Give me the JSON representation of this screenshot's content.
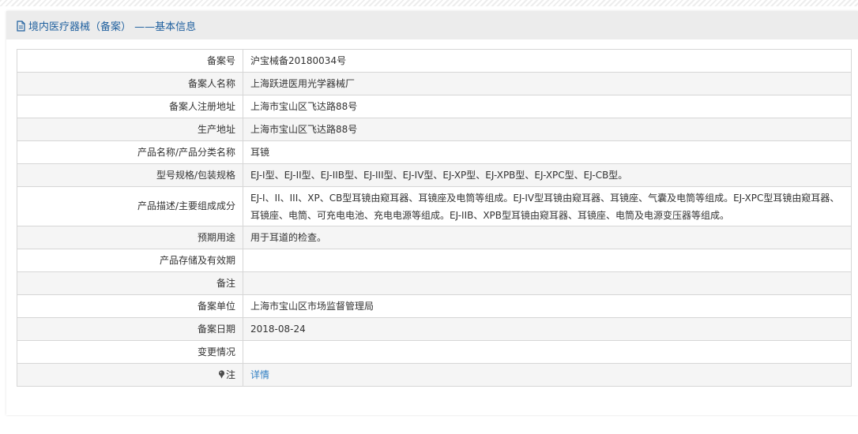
{
  "panel": {
    "title": "境内医疗器械（备案） ——基本信息",
    "title_icon": "document-icon"
  },
  "rows": [
    {
      "label": "备案号",
      "value": "沪宝械备20180034号"
    },
    {
      "label": "备案人名称",
      "value": "上海跃进医用光学器械厂"
    },
    {
      "label": "备案人注册地址",
      "value": "上海市宝山区飞达路88号"
    },
    {
      "label": "生产地址",
      "value": "上海市宝山区飞达路88号"
    },
    {
      "label": "产品名称/产品分类名称",
      "value": "耳镜"
    },
    {
      "label": "型号规格/包装规格",
      "value": "EJ-I型、EJ-II型、EJ-IIB型、EJ-III型、EJ-IV型、EJ-XP型、EJ-XPB型、EJ-XPC型、EJ-CB型。"
    },
    {
      "label": "产品描述/主要组成成分",
      "value": "EJ-I、II、III、XP、CB型耳镜由窥耳器、耳镜座及电筒等组成。EJ-IV型耳镜由窥耳器、耳镜座、气囊及电筒等组成。EJ-XPC型耳镜由窥耳器、耳镜座、电筒、可充电电池、充电电源等组成。EJ-IIB、XPB型耳镜由窥耳器、耳镜座、电筒及电源变压器等组成。"
    },
    {
      "label": "预期用途",
      "value": "用于耳道的检查。"
    },
    {
      "label": "产品存储及有效期",
      "value": ""
    },
    {
      "label": "备注",
      "value": ""
    },
    {
      "label": "备案单位",
      "value": "上海市宝山区市场监督管理局"
    },
    {
      "label": "备案日期",
      "value": "2018-08-24"
    },
    {
      "label": "变更情况",
      "value": ""
    },
    {
      "label": "注",
      "value": "详情",
      "label_icon": "pin-icon"
    }
  ],
  "colors": {
    "title": "#1e5f9e",
    "link": "#2f7ec3",
    "header_bg": "#ececec",
    "row_shade": "#f5f5f5",
    "border": "#d6d6d6"
  }
}
